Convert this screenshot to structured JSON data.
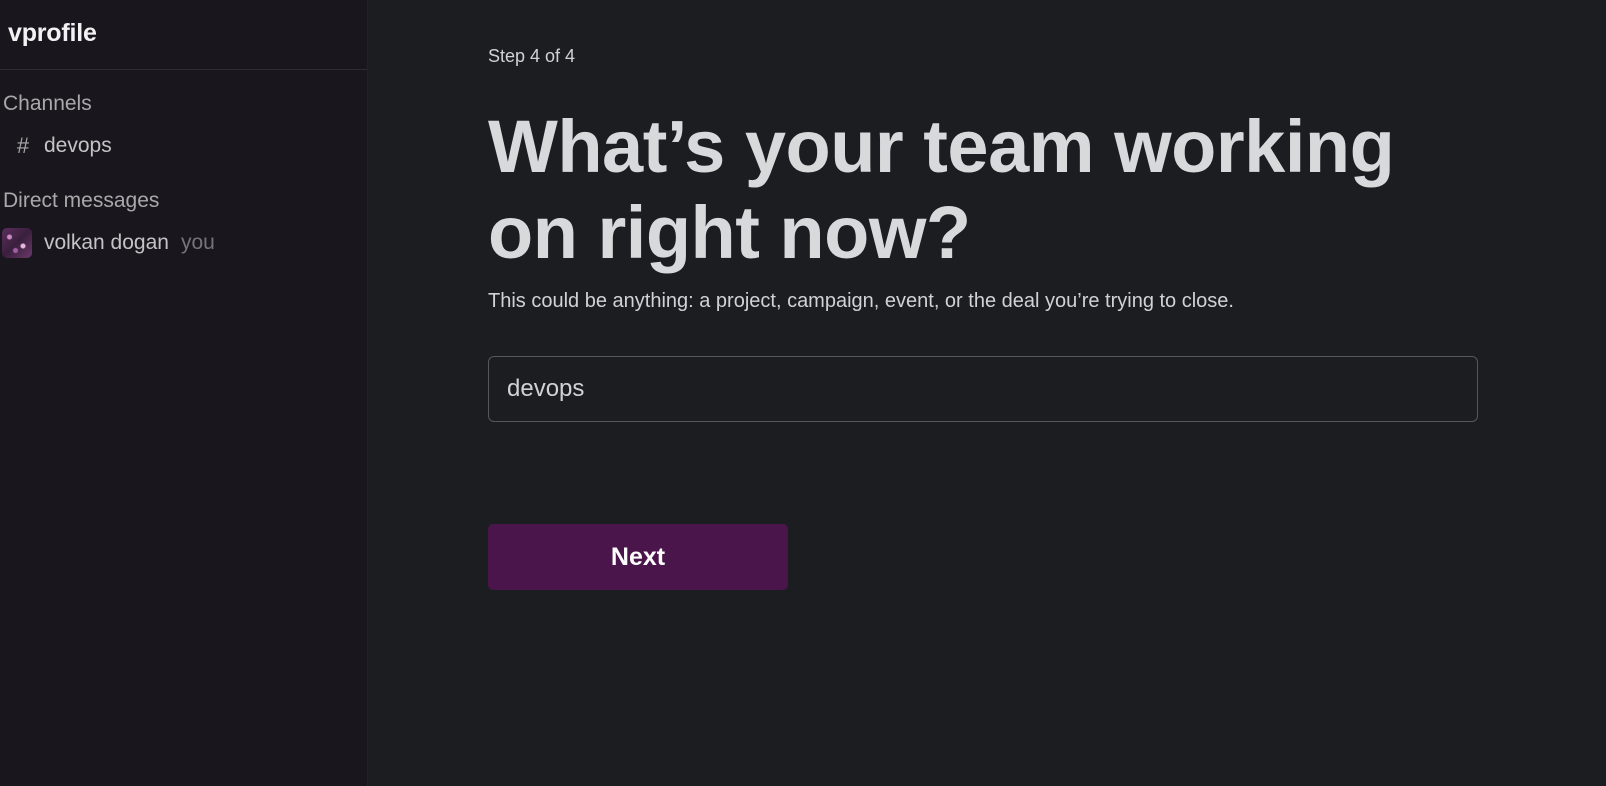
{
  "sidebar": {
    "workspace_name": "vprofile",
    "channels_title": "Channels",
    "channels": [
      {
        "icon": "hash-icon",
        "symbol": "#",
        "label": "devops"
      }
    ],
    "dms_title": "Direct messages",
    "direct_messages": [
      {
        "name": "volkan dogan",
        "suffix": "you"
      }
    ]
  },
  "main": {
    "step": "Step 4 of 4",
    "heading": "What’s your team working on right now?",
    "subtext": "This could be anything: a project, campaign, event, or the deal you’re trying to close.",
    "input_value": "devops",
    "next_label": "Next"
  },
  "colors": {
    "sidebar_bg": "#19171d",
    "main_bg": "#1b1d21",
    "button_bg": "#4a154b"
  }
}
